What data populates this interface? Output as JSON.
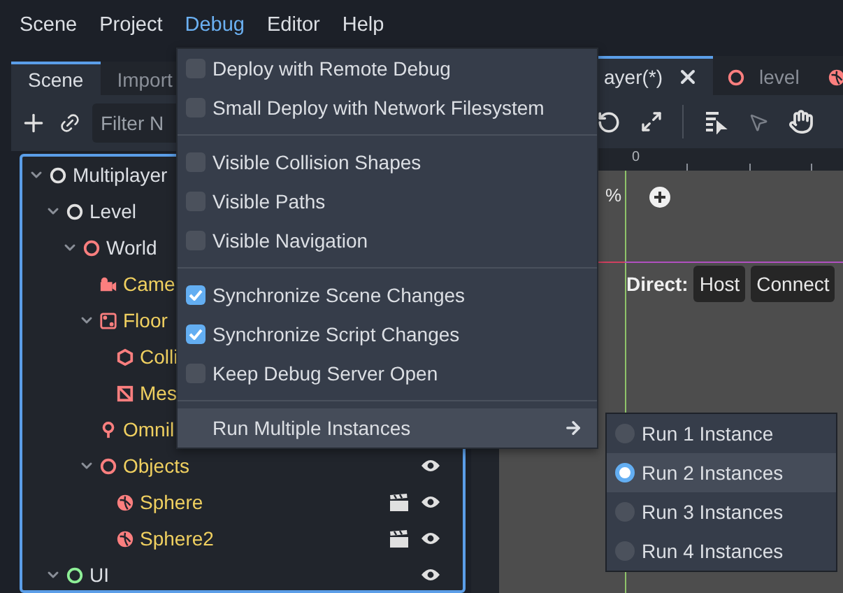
{
  "menubar": [
    {
      "label": "Scene",
      "selected": false
    },
    {
      "label": "Project",
      "selected": false
    },
    {
      "label": "Debug",
      "selected": true
    },
    {
      "label": "Editor",
      "selected": false
    },
    {
      "label": "Help",
      "selected": false
    }
  ],
  "dock": {
    "tabs": [
      {
        "label": "Scene",
        "selected": true
      },
      {
        "label": "Import",
        "selected": false
      }
    ],
    "filter": {
      "placeholder": "Filter N"
    },
    "tree": [
      {
        "name": "Multiplayer",
        "kind": "node",
        "color": "#e0e0e0",
        "inherited": false,
        "expanded": true,
        "children": [
          {
            "name": "Level",
            "kind": "node",
            "color": "#e0e0e0",
            "inherited": false,
            "expanded": true,
            "children": [
              {
                "name": "World",
                "kind": "node",
                "color": "#fc7f7f",
                "inherited": false,
                "expanded": true,
                "children": [
                  {
                    "name": "Came",
                    "kind": "camera",
                    "color": "#fc7f7f",
                    "inherited": true
                  },
                  {
                    "name": "Floor",
                    "kind": "area",
                    "color": "#fc7f7f",
                    "inherited": true,
                    "expanded": true,
                    "children": [
                      {
                        "name": "Colli",
                        "kind": "collision",
                        "color": "#fc7f7f",
                        "inherited": true
                      },
                      {
                        "name": "Mes",
                        "kind": "mesh",
                        "color": "#fc7f7f",
                        "inherited": true
                      }
                    ]
                  },
                  {
                    "name": "Omnil",
                    "kind": "light",
                    "color": "#fc7f7f",
                    "inherited": true
                  },
                  {
                    "name": "Objects",
                    "kind": "node",
                    "color": "#fc7f7f",
                    "inherited": true,
                    "expanded": true,
                    "visible": true,
                    "children": [
                      {
                        "name": "Sphere",
                        "kind": "sphere",
                        "color": "#fc7f7f",
                        "inherited": true,
                        "scene_instance": true,
                        "visible": true
                      },
                      {
                        "name": "Sphere2",
                        "kind": "sphere",
                        "color": "#fc7f7f",
                        "inherited": true,
                        "scene_instance": true,
                        "visible": true
                      }
                    ]
                  }
                ]
              }
            ]
          },
          {
            "name": "UI",
            "kind": "node",
            "color": "#8eef97",
            "inherited": false,
            "expanded": true,
            "visible": true
          }
        ]
      }
    ]
  },
  "editor": {
    "tabs": [
      {
        "label": "ayer(*)",
        "selected": true,
        "closable": true
      },
      {
        "label": "level",
        "kind": "node",
        "color": "#fc7f7f",
        "selected": false
      },
      {
        "kind": "sphere",
        "color": "#fc7f7f",
        "selected": false
      }
    ],
    "ruler_label": "0",
    "zoom_label": "%",
    "direct": {
      "label": "Direct:",
      "buttons": [
        "Host",
        "Connect"
      ]
    }
  },
  "debug_menu": {
    "items": [
      {
        "kind": "checkbox",
        "label": "Deploy with Remote Debug",
        "checked": false
      },
      {
        "kind": "checkbox",
        "label": "Small Deploy with Network Filesystem",
        "checked": false
      },
      {
        "kind": "separator"
      },
      {
        "kind": "checkbox",
        "label": "Visible Collision Shapes",
        "checked": false
      },
      {
        "kind": "checkbox",
        "label": "Visible Paths",
        "checked": false
      },
      {
        "kind": "checkbox",
        "label": "Visible Navigation",
        "checked": false
      },
      {
        "kind": "separator"
      },
      {
        "kind": "checkbox",
        "label": "Synchronize Scene Changes",
        "checked": true
      },
      {
        "kind": "checkbox",
        "label": "Synchronize Script Changes",
        "checked": true
      },
      {
        "kind": "checkbox",
        "label": "Keep Debug Server Open",
        "checked": false
      },
      {
        "kind": "separator"
      },
      {
        "kind": "submenu",
        "label": "Run Multiple Instances",
        "hovered": true
      }
    ]
  },
  "submenu": {
    "items": [
      {
        "label": "Run 1 Instance",
        "selected": false,
        "hovered": false
      },
      {
        "label": "Run 2 Instances",
        "selected": true,
        "hovered": true
      },
      {
        "label": "Run 3 Instances",
        "selected": false,
        "hovered": false
      },
      {
        "label": "Run 4 Instances",
        "selected": false,
        "hovered": false
      }
    ]
  }
}
